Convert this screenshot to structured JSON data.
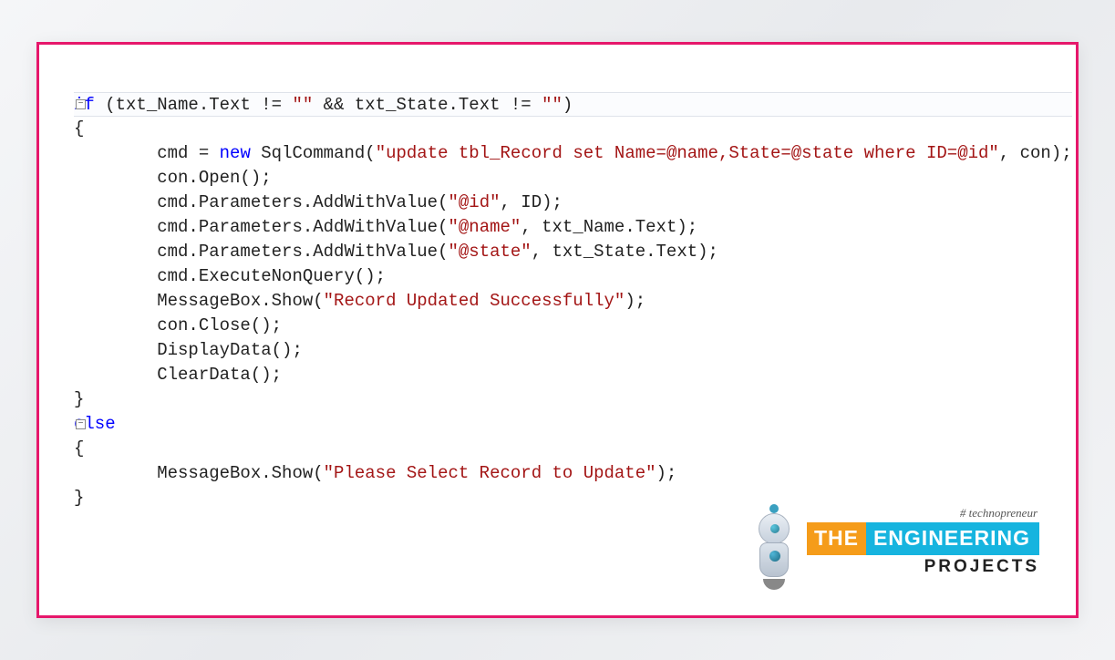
{
  "code": {
    "lines": [
      {
        "indent": 0,
        "fold": true,
        "segments": [
          {
            "t": "if",
            "c": "kw"
          },
          {
            "t": " (txt_Name.Text != "
          },
          {
            "t": "\"\"",
            "c": "str"
          },
          {
            "t": " && txt_State.Text != "
          },
          {
            "t": "\"\"",
            "c": "str"
          },
          {
            "t": ")"
          }
        ],
        "hl": true
      },
      {
        "indent": 0,
        "segments": [
          {
            "t": "{"
          }
        ]
      },
      {
        "indent": 2,
        "segments": [
          {
            "t": "cmd = "
          },
          {
            "t": "new",
            "c": "kw"
          },
          {
            "t": " SqlCommand("
          },
          {
            "t": "\"update tbl_Record set Name=@name,State=@state where ID=@id\"",
            "c": "str"
          },
          {
            "t": ", con);"
          }
        ]
      },
      {
        "indent": 2,
        "segments": [
          {
            "t": "con.Open();"
          }
        ]
      },
      {
        "indent": 2,
        "segments": [
          {
            "t": "cmd.Parameters.AddWithValue("
          },
          {
            "t": "\"@id\"",
            "c": "str"
          },
          {
            "t": ", ID);"
          }
        ]
      },
      {
        "indent": 2,
        "segments": [
          {
            "t": "cmd.Parameters.AddWithValue("
          },
          {
            "t": "\"@name\"",
            "c": "str"
          },
          {
            "t": ", txt_Name.Text);"
          }
        ]
      },
      {
        "indent": 2,
        "segments": [
          {
            "t": "cmd.Parameters.AddWithValue("
          },
          {
            "t": "\"@state\"",
            "c": "str"
          },
          {
            "t": ", txt_State.Text);"
          }
        ]
      },
      {
        "indent": 2,
        "segments": [
          {
            "t": "cmd.ExecuteNonQuery();"
          }
        ]
      },
      {
        "indent": 2,
        "segments": [
          {
            "t": "MessageBox.Show("
          },
          {
            "t": "\"Record Updated Successfully\"",
            "c": "str"
          },
          {
            "t": ");"
          }
        ]
      },
      {
        "indent": 2,
        "segments": [
          {
            "t": "con.Close();"
          }
        ]
      },
      {
        "indent": 2,
        "segments": [
          {
            "t": "DisplayData();"
          }
        ]
      },
      {
        "indent": 2,
        "segments": [
          {
            "t": "ClearData();"
          }
        ]
      },
      {
        "indent": 0,
        "segments": [
          {
            "t": "}"
          }
        ]
      },
      {
        "indent": 0,
        "fold": true,
        "segments": [
          {
            "t": "else",
            "c": "kw"
          }
        ]
      },
      {
        "indent": 0,
        "segments": [
          {
            "t": "{"
          }
        ]
      },
      {
        "indent": 2,
        "segments": [
          {
            "t": "MessageBox.Show("
          },
          {
            "t": "\"Please Select Record to Update\"",
            "c": "str"
          },
          {
            "t": ");"
          }
        ]
      },
      {
        "indent": 0,
        "segments": [
          {
            "t": "}"
          }
        ]
      }
    ]
  },
  "logo": {
    "tagline": "# technopreneur",
    "the": "THE",
    "engineering": "ENGINEERING",
    "projects": "PROJECTS"
  }
}
